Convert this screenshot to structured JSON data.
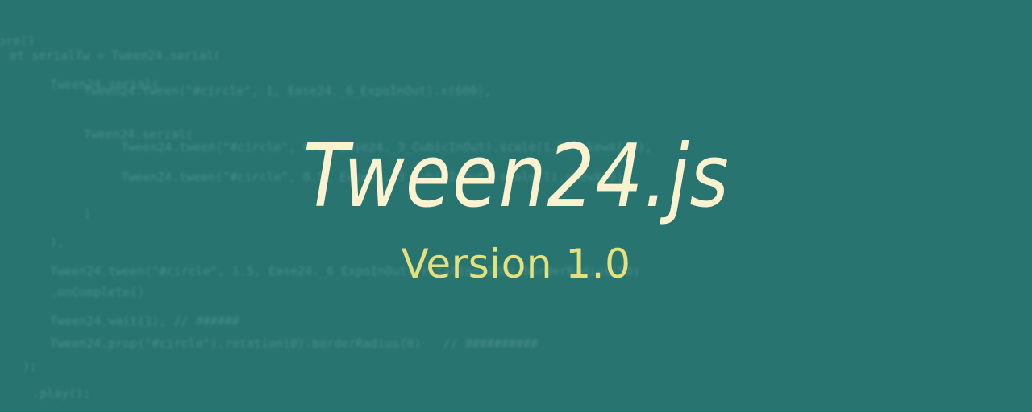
{
  "banner": {
    "title": "Tween24.js",
    "subtitle": "Version 1.0"
  },
  "colors": {
    "background": "#287471",
    "title": "#fbf3cf",
    "subtitle": "#e3e07e",
    "background_code": "#5fa39d"
  }
}
